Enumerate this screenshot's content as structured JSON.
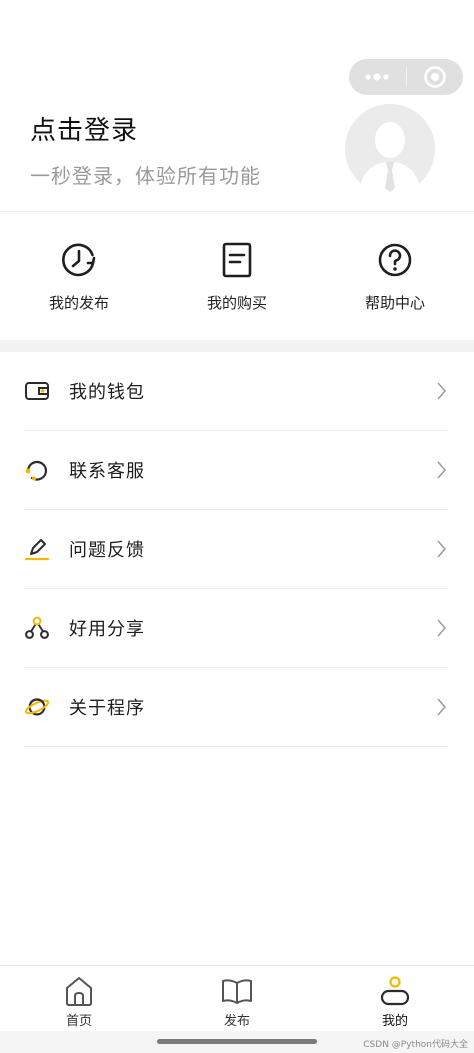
{
  "header": {
    "login_title": "点击登录",
    "login_subtitle": "一秒登录，体验所有功能"
  },
  "quick_actions": [
    {
      "label": "我的发布",
      "icon": "clock-arrow-icon"
    },
    {
      "label": "我的购买",
      "icon": "document-list-icon"
    },
    {
      "label": "帮助中心",
      "icon": "help-circle-icon"
    }
  ],
  "menu": [
    {
      "label": "我的钱包",
      "icon": "wallet-icon"
    },
    {
      "label": "联系客服",
      "icon": "headset-icon"
    },
    {
      "label": "问题反馈",
      "icon": "pencil-icon"
    },
    {
      "label": "好用分享",
      "icon": "share-nodes-icon"
    },
    {
      "label": "关于程序",
      "icon": "planet-icon"
    }
  ],
  "tabbar": [
    {
      "label": "首页",
      "icon": "home-icon",
      "active": false
    },
    {
      "label": "发布",
      "icon": "book-icon",
      "active": false
    },
    {
      "label": "我的",
      "icon": "user-icon",
      "active": true
    }
  ],
  "colors": {
    "accent": "#f5b800",
    "icon_dark": "#2b2b2b"
  },
  "watermark": "CSDN @Python代码大全"
}
